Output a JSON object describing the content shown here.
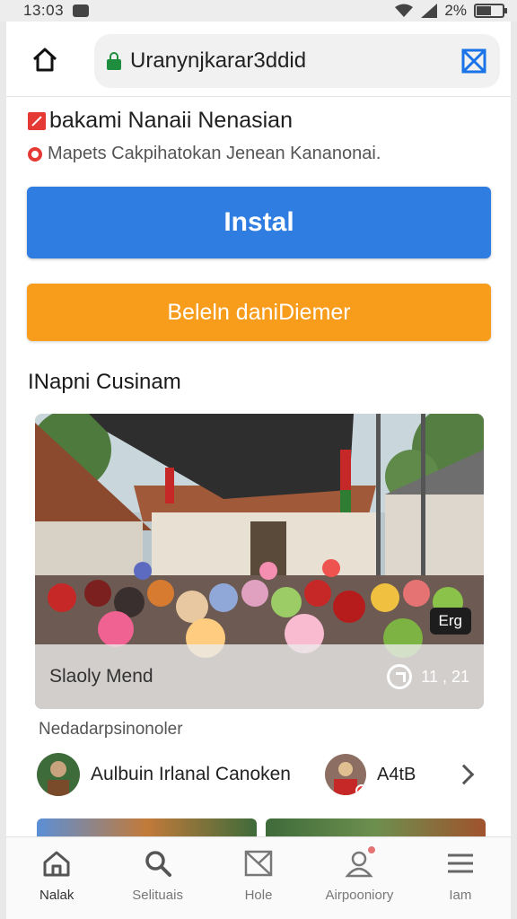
{
  "status_bar": {
    "time": "13:03",
    "battery": "2%"
  },
  "browser": {
    "url": "Uranynjkarar3ddid",
    "icons": [
      "home-icon",
      "lock-icon",
      "tab-switcher-icon"
    ]
  },
  "ad": {
    "title": "bakami Nanaii Nenasian",
    "subtitle": "Mapets Cakpihatokan Jenean Kananonai.",
    "install_label": "Instal",
    "secondary_label": "Beleln daniDiemer"
  },
  "section": {
    "title": "INapni Cusinam"
  },
  "media": {
    "caption": "Slaoly Mend",
    "time": "11 , 21",
    "badge": "Erg"
  },
  "recommended": {
    "label": "Nedadarpsinonoler",
    "author_name": "Aulbuin Irlanal Canoken",
    "author_handle": "A4tB"
  },
  "bottom_nav": {
    "items": [
      {
        "label": "Nalak",
        "icon": "home-icon"
      },
      {
        "label": "Selituais",
        "icon": "search-icon"
      },
      {
        "label": "Hole",
        "icon": "mail-icon"
      },
      {
        "label": "Airpooniory",
        "icon": "profile-icon"
      },
      {
        "label": "Iam",
        "icon": "menu-icon"
      }
    ]
  },
  "colors": {
    "install": "#2f7de1",
    "secondary": "#f89c1c",
    "lock": "#1e8e3e",
    "ad_badge": "#e53935"
  }
}
